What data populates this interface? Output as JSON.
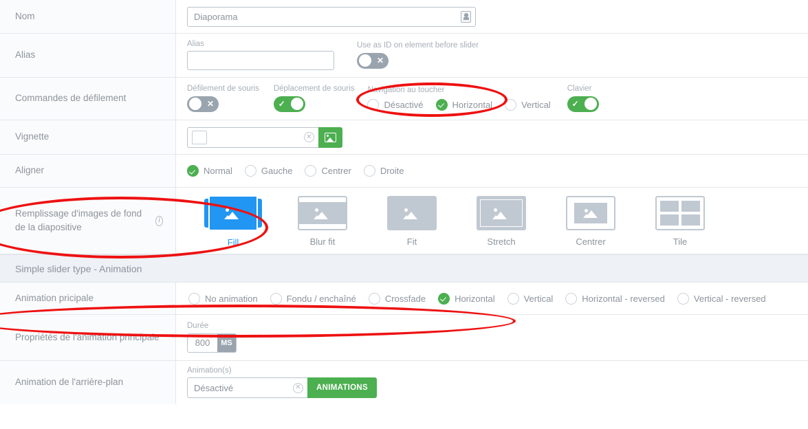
{
  "rows": {
    "name": {
      "label": "Nom",
      "value": "Diaporama",
      "icon": "id-card-icon"
    },
    "alias": {
      "label": "Alias",
      "field_caption": "Alias",
      "value": "",
      "toggle_caption": "Use as ID on element before slider",
      "toggle_state": "off"
    },
    "scroll_controls": {
      "label": "Commandes de défilement",
      "mouse_scroll": {
        "caption": "Défilement de souris",
        "state": "off"
      },
      "mouse_drag": {
        "caption": "Déplacement de souris",
        "state": "on"
      },
      "touch_nav": {
        "caption": "Navigation au toucher",
        "options": [
          "Désactivé",
          "Horizontal",
          "Vertical"
        ],
        "selected": "Horizontal"
      },
      "keyboard": {
        "caption": "Clavier",
        "state": "on"
      }
    },
    "thumbnail": {
      "label": "Vignette",
      "value": "",
      "clear_icon": "clear-circle-icon",
      "button_icon": "picture-icon"
    },
    "align": {
      "label": "Aligner",
      "options": [
        "Normal",
        "Gauche",
        "Centrer",
        "Droite"
      ],
      "selected": "Normal"
    },
    "bg_fill": {
      "label": "Remplissage d'images de fond de la diapositive",
      "info_icon": "info-icon",
      "options": [
        "Fill",
        "Blur fit",
        "Fit",
        "Stretch",
        "Centrer",
        "Tile"
      ],
      "selected": "Fill"
    }
  },
  "section": {
    "title": "Simple slider type - Animation"
  },
  "animation": {
    "main": {
      "label": "Animation pricipale",
      "options": [
        "No animation",
        "Fondu / enchaîné",
        "Crossfade",
        "Horizontal",
        "Vertical",
        "Horizontal - reversed",
        "Vertical - reversed"
      ],
      "selected": "Horizontal"
    },
    "properties": {
      "label": "Propriétés de l'animation principale",
      "duration_caption": "Durée",
      "duration_value": "800",
      "duration_unit": "MS"
    },
    "background": {
      "label": "Animation de l'arrière-plan",
      "caption": "Animation(s)",
      "value": "Désactivé",
      "clear_icon": "clear-circle-icon",
      "button_label": "ANIMATIONS"
    }
  },
  "colors": {
    "accent_green": "#4caf50",
    "accent_blue": "#2196f3",
    "annotation_red": "#ee1111",
    "label_grey": "#8d949c",
    "section_bg": "#eef1f6"
  }
}
